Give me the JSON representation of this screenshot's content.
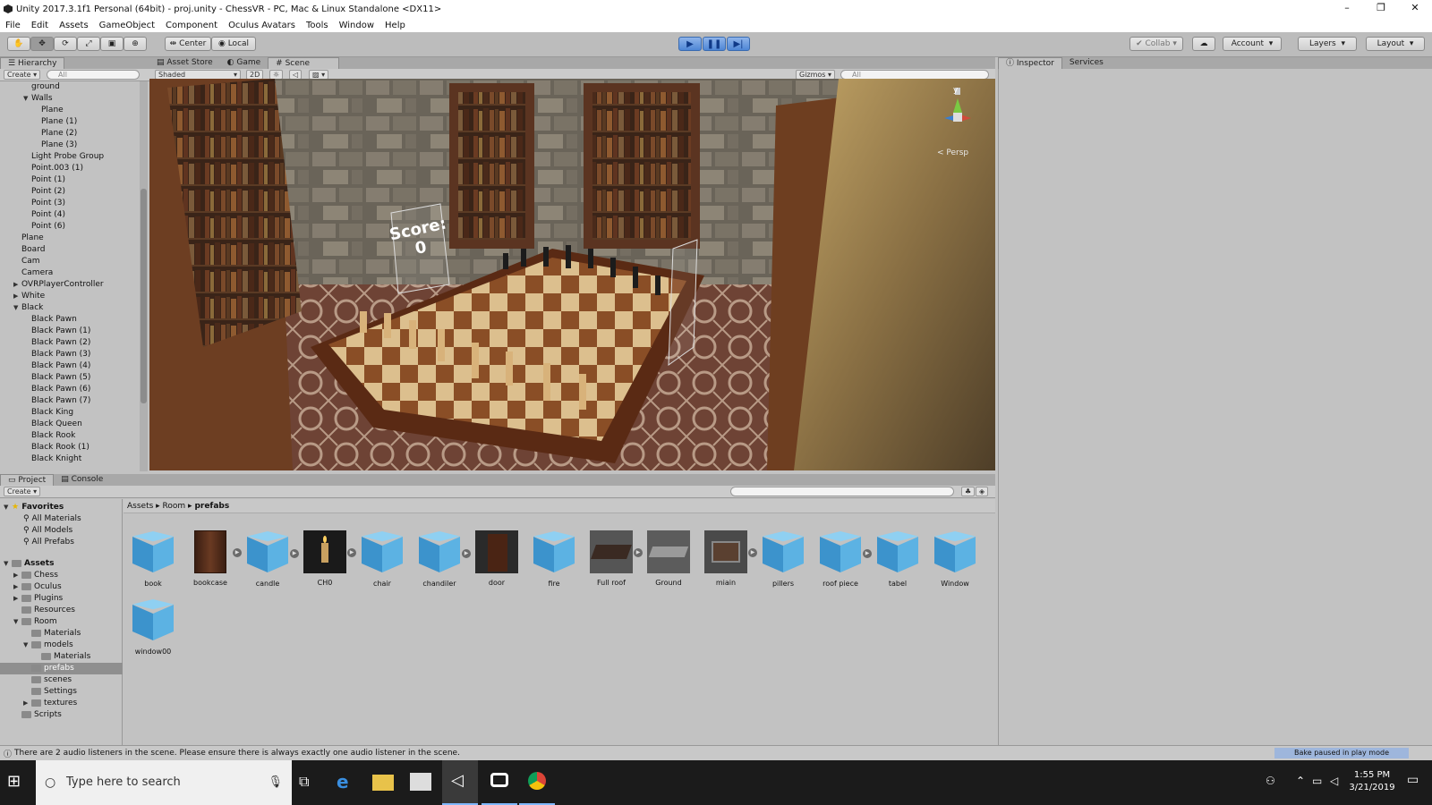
{
  "window": {
    "title": "Unity 2017.3.1f1 Personal (64bit) - proj.unity - ChessVR - PC, Mac & Linux Standalone <DX11>",
    "minimize": "–",
    "maximize": "❐",
    "close": "✕"
  },
  "menu": [
    "File",
    "Edit",
    "Assets",
    "GameObject",
    "Component",
    "Oculus Avatars",
    "Tools",
    "Window",
    "Help"
  ],
  "toolbar": {
    "center": "Center",
    "local": "Local",
    "collab": "Collab",
    "account": "Account",
    "layers": "Layers",
    "layout": "Layout"
  },
  "hierarchy": {
    "tab": "Hierarchy",
    "create": "Create",
    "search_placeholder": "All",
    "items": [
      {
        "label": "ground",
        "indent": 2,
        "arrow": ""
      },
      {
        "label": "Walls",
        "indent": 2,
        "arrow": "▼"
      },
      {
        "label": "Plane",
        "indent": 3,
        "arrow": ""
      },
      {
        "label": "Plane (1)",
        "indent": 3,
        "arrow": ""
      },
      {
        "label": "Plane (2)",
        "indent": 3,
        "arrow": ""
      },
      {
        "label": "Plane (3)",
        "indent": 3,
        "arrow": ""
      },
      {
        "label": "Light Probe Group",
        "indent": 2,
        "arrow": ""
      },
      {
        "label": "Point.003 (1)",
        "indent": 2,
        "arrow": ""
      },
      {
        "label": "Point (1)",
        "indent": 2,
        "arrow": ""
      },
      {
        "label": "Point (2)",
        "indent": 2,
        "arrow": ""
      },
      {
        "label": "Point (3)",
        "indent": 2,
        "arrow": ""
      },
      {
        "label": "Point (4)",
        "indent": 2,
        "arrow": ""
      },
      {
        "label": "Point (6)",
        "indent": 2,
        "arrow": ""
      },
      {
        "label": "Plane",
        "indent": 1,
        "arrow": ""
      },
      {
        "label": "Board",
        "indent": 1,
        "arrow": ""
      },
      {
        "label": "Cam",
        "indent": 1,
        "arrow": ""
      },
      {
        "label": "Camera",
        "indent": 1,
        "arrow": ""
      },
      {
        "label": "OVRPlayerController",
        "indent": 1,
        "arrow": "▶"
      },
      {
        "label": "White",
        "indent": 1,
        "arrow": "▶"
      },
      {
        "label": "Black",
        "indent": 1,
        "arrow": "▼"
      },
      {
        "label": "Black Pawn",
        "indent": 2,
        "arrow": ""
      },
      {
        "label": "Black Pawn (1)",
        "indent": 2,
        "arrow": ""
      },
      {
        "label": "Black Pawn (2)",
        "indent": 2,
        "arrow": ""
      },
      {
        "label": "Black Pawn (3)",
        "indent": 2,
        "arrow": ""
      },
      {
        "label": "Black Pawn (4)",
        "indent": 2,
        "arrow": ""
      },
      {
        "label": "Black Pawn (5)",
        "indent": 2,
        "arrow": ""
      },
      {
        "label": "Black Pawn (6)",
        "indent": 2,
        "arrow": ""
      },
      {
        "label": "Black Pawn (7)",
        "indent": 2,
        "arrow": ""
      },
      {
        "label": "Black King",
        "indent": 2,
        "arrow": ""
      },
      {
        "label": "Black Queen",
        "indent": 2,
        "arrow": ""
      },
      {
        "label": "Black Rook",
        "indent": 2,
        "arrow": ""
      },
      {
        "label": "Black Rook (1)",
        "indent": 2,
        "arrow": ""
      },
      {
        "label": "Black Knight",
        "indent": 2,
        "arrow": ""
      }
    ]
  },
  "scene_tabs": {
    "asset_store": "Asset Store",
    "game": "Game",
    "scene": "Scene"
  },
  "scene_bar": {
    "shading": "Shaded",
    "mode_2d": "2D",
    "gizmos": "Gizmos",
    "search_placeholder": "All"
  },
  "scene": {
    "score_label": "Score:",
    "score_value": "0",
    "persp": "< Persp",
    "axis_y": "y"
  },
  "right_tabs": {
    "inspector": "Inspector",
    "services": "Services"
  },
  "project": {
    "tab_project": "Project",
    "tab_console": "Console",
    "create": "Create",
    "breadcrumb": [
      "Assets",
      "Room",
      "prefabs"
    ],
    "favorites": {
      "title": "Favorites",
      "items": [
        "All Materials",
        "All Models",
        "All Prefabs"
      ]
    },
    "assets_tree": [
      {
        "label": "Assets",
        "indent": 0,
        "arrow": "▼",
        "bold": true
      },
      {
        "label": "Chess",
        "indent": 1,
        "arrow": "▶"
      },
      {
        "label": "Oculus",
        "indent": 1,
        "arrow": "▶"
      },
      {
        "label": "Plugins",
        "indent": 1,
        "arrow": "▶"
      },
      {
        "label": "Resources",
        "indent": 1,
        "arrow": ""
      },
      {
        "label": "Room",
        "indent": 1,
        "arrow": "▼"
      },
      {
        "label": "Materials",
        "indent": 2,
        "arrow": ""
      },
      {
        "label": "models",
        "indent": 2,
        "arrow": "▼"
      },
      {
        "label": "Materials",
        "indent": 3,
        "arrow": ""
      },
      {
        "label": "prefabs",
        "indent": 2,
        "arrow": "",
        "selected": true
      },
      {
        "label": "scenes",
        "indent": 2,
        "arrow": ""
      },
      {
        "label": "Settings",
        "indent": 2,
        "arrow": ""
      },
      {
        "label": "textures",
        "indent": 2,
        "arrow": "▶"
      },
      {
        "label": "Scripts",
        "indent": 1,
        "arrow": ""
      }
    ],
    "assets": [
      {
        "label": "book",
        "kind": "cube",
        "expand": false
      },
      {
        "label": "bookcase",
        "kind": "bookcase",
        "expand": true
      },
      {
        "label": "candle",
        "kind": "cube",
        "expand": true
      },
      {
        "label": "CH0",
        "kind": "candle",
        "expand": true
      },
      {
        "label": "chair",
        "kind": "cube",
        "expand": false
      },
      {
        "label": "chandiler",
        "kind": "cube",
        "expand": true
      },
      {
        "label": "door",
        "kind": "door",
        "expand": false
      },
      {
        "label": "fire",
        "kind": "cube",
        "expand": false
      },
      {
        "label": "Full roof",
        "kind": "roof",
        "expand": true
      },
      {
        "label": "Ground",
        "kind": "ground",
        "expand": false
      },
      {
        "label": "miain",
        "kind": "main",
        "expand": true
      },
      {
        "label": "pillers",
        "kind": "cube",
        "expand": false
      },
      {
        "label": "roof piece",
        "kind": "cube",
        "expand": true
      },
      {
        "label": "tabel",
        "kind": "cube",
        "expand": false
      },
      {
        "label": "Window",
        "kind": "cube",
        "expand": false
      },
      {
        "label": "window00",
        "kind": "cube",
        "expand": false
      }
    ]
  },
  "status": {
    "message": "There are 2 audio listeners in the scene. Please ensure there is always exactly one audio listener in the scene.",
    "bake": "Bake paused in play mode"
  },
  "taskbar": {
    "search_placeholder": "Type here to search",
    "time": "1:55 PM",
    "date": "3/21/2019"
  }
}
